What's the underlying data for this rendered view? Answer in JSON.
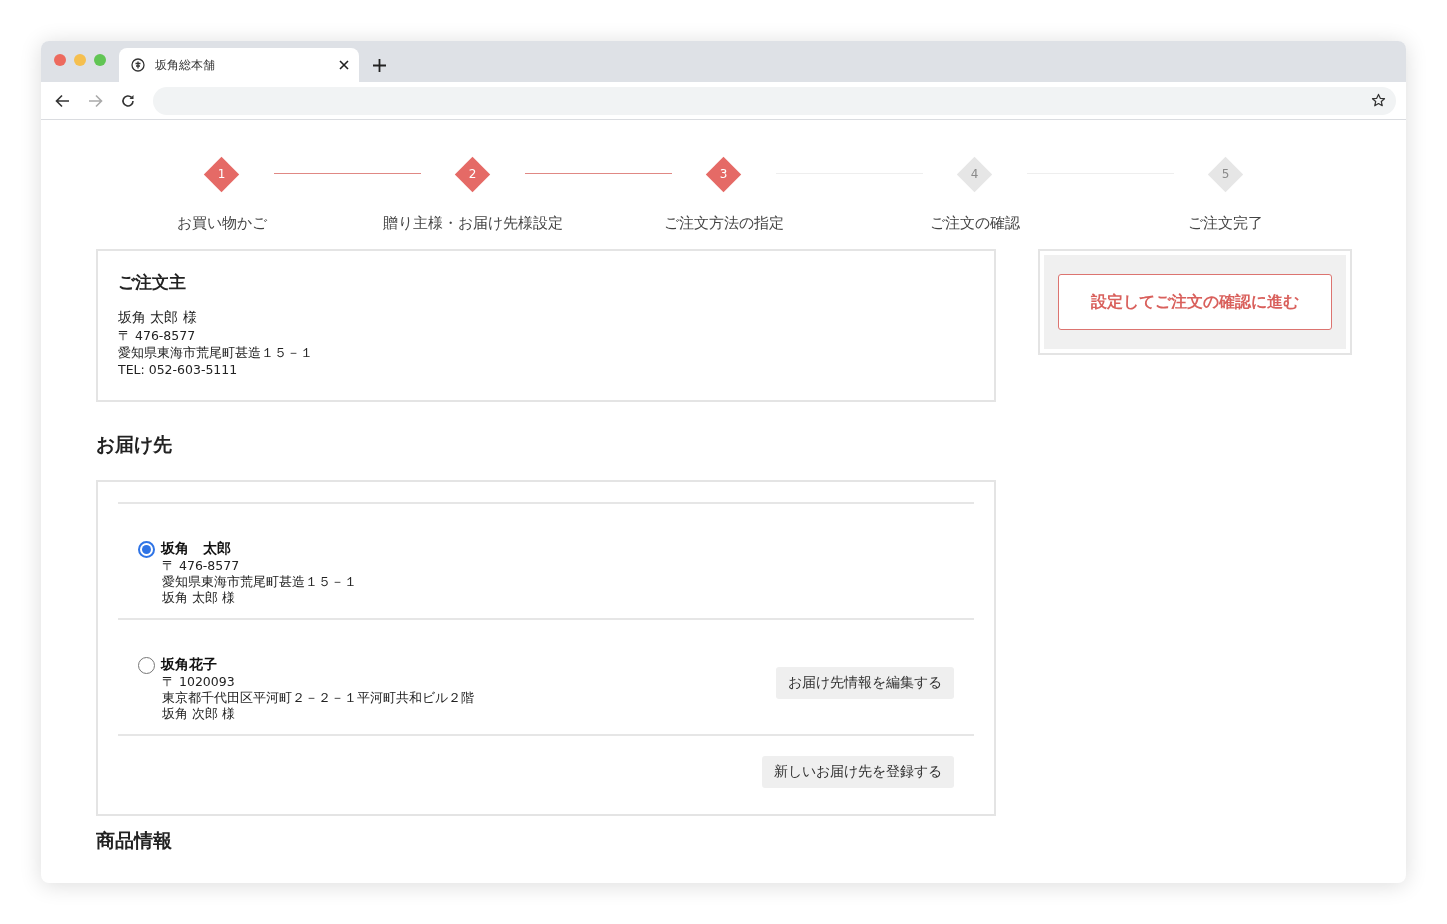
{
  "browser": {
    "tab_title": "坂角総本舗"
  },
  "steps": [
    {
      "number": "1",
      "label": "お買い物かご",
      "done": true
    },
    {
      "number": "2",
      "label": "贈り主様・お届け先様設定",
      "done": true
    },
    {
      "number": "3",
      "label": "ご注文方法の指定",
      "done": true
    },
    {
      "number": "4",
      "label": "ご注文の確認",
      "done": false
    },
    {
      "number": "5",
      "label": "ご注文完了",
      "done": false
    }
  ],
  "orderer": {
    "heading": "ご注文主",
    "name": "坂角 太郎 様",
    "postal": "〒 476-8577",
    "address": "愛知県東海市荒尾町甚造１５－１",
    "tel": "TEL: 052-603-5111"
  },
  "delivery": {
    "heading": "お届け先",
    "addresses": [
      {
        "name": "坂角　太郎",
        "postal": "〒 476-8577",
        "address": "愛知県東海市荒尾町甚造１５－１",
        "recipient": "坂角 太郎 様",
        "selected": true
      },
      {
        "name": "坂角花子",
        "postal": "〒 1020093",
        "address": "東京都千代田区平河町２－２－１平河町共和ビル２階",
        "recipient": "坂角 次郎 様",
        "selected": false,
        "edit_button": "お届け先情報を編集する"
      }
    ],
    "new_button": "新しいお届け先を登録する"
  },
  "next_section": {
    "heading": "商品情報"
  },
  "side": {
    "proceed_button": "設定してご注文の確認に進む"
  }
}
